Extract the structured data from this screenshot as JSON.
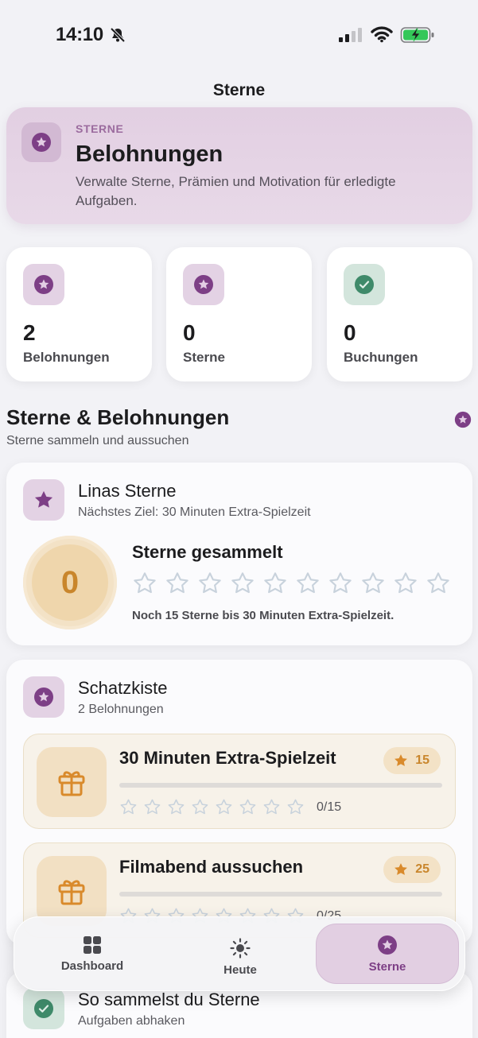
{
  "status_bar": {
    "time": "14:10",
    "icons": [
      "bell-slash-icon",
      "signal-icon",
      "wifi-icon",
      "battery-charging-icon"
    ]
  },
  "nav": {
    "title": "Sterne"
  },
  "hero": {
    "eyebrow": "STERNE",
    "title": "Belohnungen",
    "subtitle": "Verwalte Sterne, Prämien und Motivation für erledigte Aufgaben.",
    "icon": "star-circle-icon"
  },
  "stats": [
    {
      "value": "2",
      "label": "Belohnungen",
      "icon": "star-circle-icon",
      "color": "#7d3f86"
    },
    {
      "value": "0",
      "label": "Sterne",
      "icon": "star-circle-icon",
      "color": "#7d3f86"
    },
    {
      "value": "0",
      "label": "Buchungen",
      "icon": "checkmark-circle-icon",
      "color": "#3f8a6a"
    }
  ],
  "section": {
    "title": "Sterne & Belohnungen",
    "subtitle": "Sterne sammeln und aussuchen"
  },
  "stars_card": {
    "title": "Linas Sterne",
    "subtitle": "Nächstes Ziel: 30 Minuten Extra-Spielzeit",
    "count": "0",
    "collected_title": "Sterne gesammelt",
    "star_slots": 10,
    "filled": 0,
    "note": "Noch 15 Sterne bis 30 Minuten Extra-Spielzeit."
  },
  "treasure": {
    "title": "Schatzkiste",
    "subtitle": "2 Belohnungen",
    "rewards": [
      {
        "title": "30 Minuten Extra-Spielzeit",
        "cost": "15",
        "progress_text": "0/15",
        "progress": 0
      },
      {
        "title": "Filmabend aussuchen",
        "cost": "25",
        "progress_text": "0/25",
        "progress": 0
      }
    ]
  },
  "howto": {
    "title": "So sammelst du Sterne",
    "subtitle": "Aufgaben abhaken"
  },
  "tabbar": {
    "tabs": [
      {
        "label": "Dashboard",
        "icon": "grid-icon",
        "active": false
      },
      {
        "label": "Heute",
        "icon": "sun-icon",
        "active": false
      },
      {
        "label": "Sterne",
        "icon": "star-circle-icon",
        "active": true
      }
    ]
  },
  "colors": {
    "accent": "#7d3f86",
    "accent_bg": "#e2cfe2",
    "gold": "#c9862c",
    "green": "#3f8a6a"
  }
}
